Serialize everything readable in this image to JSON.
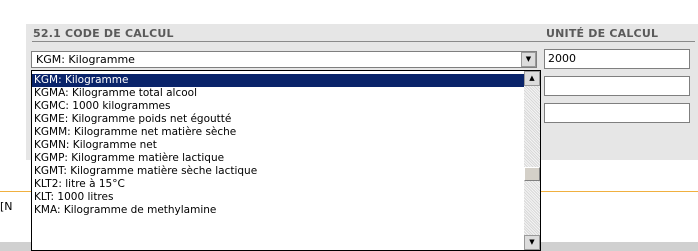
{
  "section": {
    "code_header": "52.1 CODE DE CALCUL",
    "unit_header": "UNITÉ DE CALCUL"
  },
  "select": {
    "value": "KGM: Kilogramme",
    "arrow_icon": "triangle-down"
  },
  "unit_inputs": [
    "2000",
    "",
    ""
  ],
  "side_text": "[N",
  "dropdown": {
    "options": [
      "KGM: Kilogramme",
      "KGMA: Kilogramme total alcool",
      "KGMC: 1000 kilogrammes",
      "KGME: Kilogramme poids net égoutté",
      "KGMM: Kilogramme net matière sèche",
      "KGMN: Kilogramme net",
      "KGMP: Kilogramme matière lactique",
      "KGMT: Kilogramme matière sèche lactique",
      "KLT2: litre à 15°C",
      "KLT: 1000 litres",
      "KMA: Kilogramme de methylamine"
    ],
    "selected_index": 0
  },
  "colors": {
    "panel_bg": "#e6e6e6",
    "selection_bg": "#0a246a",
    "accent_line": "#f0b040"
  }
}
